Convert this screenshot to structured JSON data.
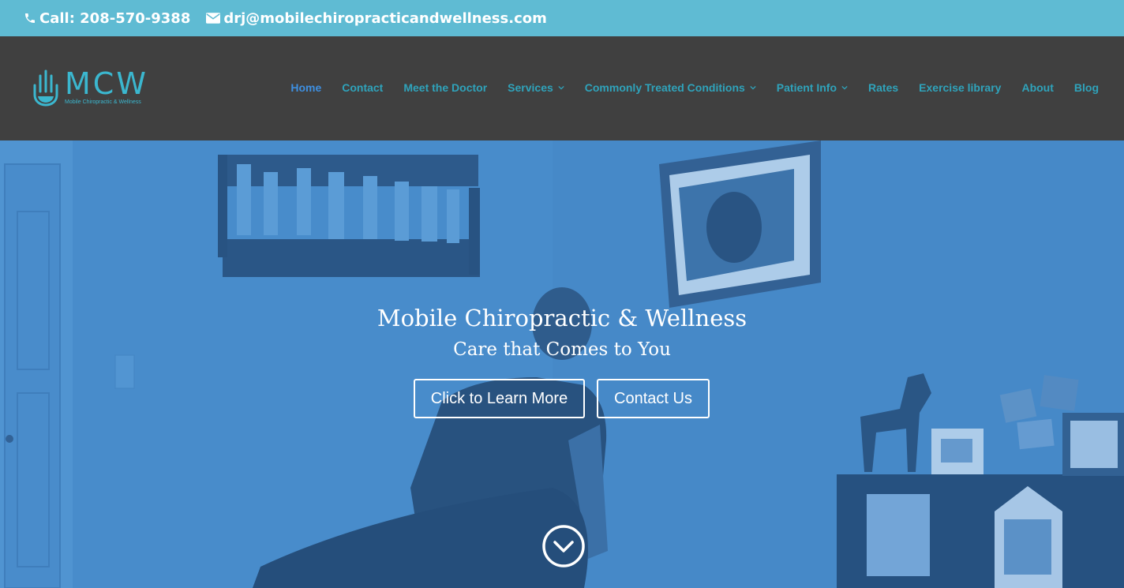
{
  "topbar": {
    "phone": "Call: 208-570-9388",
    "email": "drj@mobilechiropracticandwellness.com"
  },
  "logo": {
    "mark": "MCW",
    "tagline": "Mobile Chiropractic & Wellness"
  },
  "nav": {
    "items": [
      {
        "label": "Home",
        "active": true,
        "dropdown": false
      },
      {
        "label": "Contact",
        "active": false,
        "dropdown": false
      },
      {
        "label": "Meet the Doctor",
        "active": false,
        "dropdown": false
      },
      {
        "label": "Services",
        "active": false,
        "dropdown": true
      },
      {
        "label": "Commonly Treated Conditions",
        "active": false,
        "dropdown": true
      },
      {
        "label": "Patient Info",
        "active": false,
        "dropdown": true
      },
      {
        "label": "Rates",
        "active": false,
        "dropdown": false
      },
      {
        "label": "Exercise library",
        "active": false,
        "dropdown": false
      },
      {
        "label": "About",
        "active": false,
        "dropdown": false
      },
      {
        "label": "Blog",
        "active": false,
        "dropdown": false
      }
    ]
  },
  "hero": {
    "title": "Mobile Chiropractic & Wellness",
    "subtitle": "Care that Comes to You",
    "learn_button": "Click to Learn More",
    "contact_button": "Contact Us"
  },
  "icons": {
    "phone": "phone-icon",
    "email": "envelope-icon",
    "logo": "hand-icon",
    "caret": "chevron-down-icon",
    "scroll": "circle-chevron-down-icon"
  },
  "colors": {
    "topbar": "#5fbbd3",
    "header": "#404040",
    "nav_link": "#2fa3bb",
    "nav_active": "#3e8fe0",
    "hero_overlay": "#3f86c8"
  }
}
